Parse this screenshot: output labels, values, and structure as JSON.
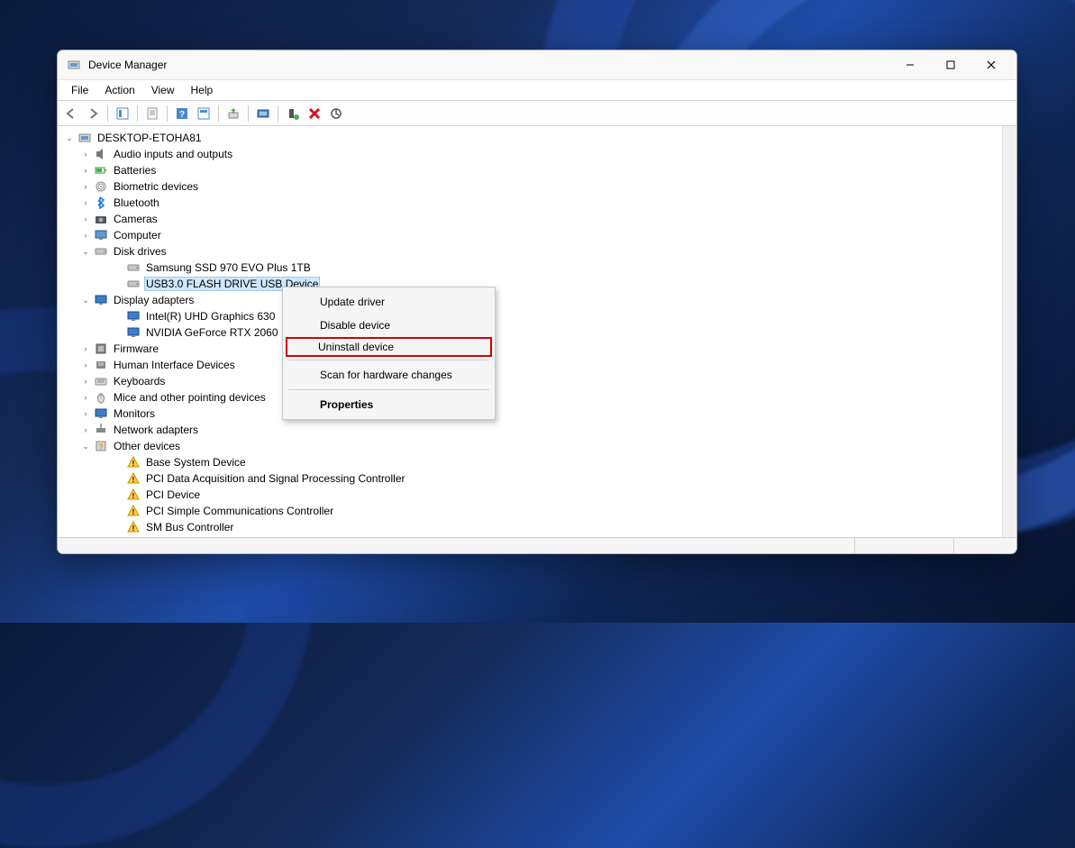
{
  "window": {
    "title": "Device Manager"
  },
  "menu": {
    "file": "File",
    "action": "Action",
    "view": "View",
    "help": "Help"
  },
  "tree": {
    "root": "DESKTOP-ETOHA81",
    "nodes": [
      {
        "label": "Audio inputs and outputs",
        "icon": "audio"
      },
      {
        "label": "Batteries",
        "icon": "battery"
      },
      {
        "label": "Biometric devices",
        "icon": "biometric"
      },
      {
        "label": "Bluetooth",
        "icon": "bluetooth"
      },
      {
        "label": "Cameras",
        "icon": "camera"
      },
      {
        "label": "Computer",
        "icon": "computer"
      },
      {
        "label": "Disk drives",
        "icon": "disk",
        "expanded": true,
        "children": [
          {
            "label": "Samsung SSD 970 EVO Plus 1TB",
            "icon": "disk"
          },
          {
            "label": "USB3.0 FLASH DRIVE USB Device",
            "icon": "disk",
            "selected": true
          }
        ]
      },
      {
        "label": "Display adapters",
        "icon": "display",
        "expanded": true,
        "children": [
          {
            "label": "Intel(R) UHD Graphics 630",
            "icon": "display"
          },
          {
            "label": "NVIDIA GeForce RTX 2060",
            "icon": "display"
          }
        ]
      },
      {
        "label": "Firmware",
        "icon": "firmware"
      },
      {
        "label": "Human Interface Devices",
        "icon": "hid"
      },
      {
        "label": "Keyboards",
        "icon": "keyboard"
      },
      {
        "label": "Mice and other pointing devices",
        "icon": "mouse"
      },
      {
        "label": "Monitors",
        "icon": "monitor"
      },
      {
        "label": "Network adapters",
        "icon": "network"
      },
      {
        "label": "Other devices",
        "icon": "other",
        "expanded": true,
        "children": [
          {
            "label": "Base System Device",
            "icon": "warn"
          },
          {
            "label": "PCI Data Acquisition and Signal Processing Controller",
            "icon": "warn"
          },
          {
            "label": "PCI Device",
            "icon": "warn"
          },
          {
            "label": "PCI Simple Communications Controller",
            "icon": "warn"
          },
          {
            "label": "SM Bus Controller",
            "icon": "warn"
          }
        ]
      }
    ]
  },
  "context_menu": {
    "update": "Update driver",
    "disable": "Disable device",
    "uninstall": "Uninstall device",
    "scan": "Scan for hardware changes",
    "properties": "Properties"
  }
}
